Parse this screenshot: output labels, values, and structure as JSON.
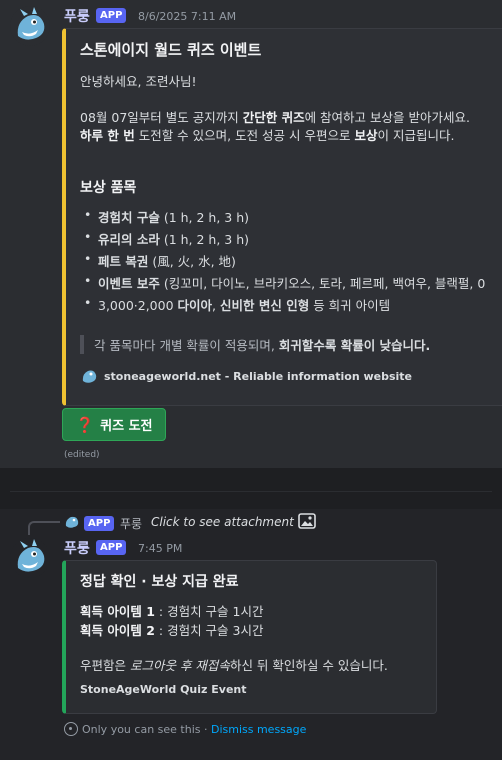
{
  "message1": {
    "username": "푸룽",
    "app_badge": "APP",
    "timestamp": "8/6/2025 7:11 AM",
    "embed": {
      "title": "스톤에이지 월드 퀴즈 이벤트",
      "greeting": "안녕하세요, 조련사님!",
      "p1_a": "08월 07일부터 별도 공지까지 ",
      "p1_b": "간단한 퀴즈",
      "p1_c": "에 참여하고 보상을 받아가세요.",
      "p2_a": "하루 한 번",
      "p2_b": " 도전할 수 있으며, 도전 성공 시 우편으로 ",
      "p2_c": "보상",
      "p2_d": "이 지급됩니다.",
      "reward_heading": "보상 품목",
      "rewards": [
        {
          "bold": "경험치 구슬",
          "rest": " (1 h, 2 h, 3 h)"
        },
        {
          "bold": "유리의 소라",
          "rest": " (1 h, 2 h, 3 h)"
        },
        {
          "bold": "페트 복권",
          "rest": " (風, 火, 水, 地)"
        },
        {
          "bold": "이벤트 보주",
          "rest": " (킹꼬미, 다이노, 브라키오스, 토라, 페르페, 백여우, 블랙펄, 0"
        },
        {
          "pre": "3,000·2,000 ",
          "bold": "다이아",
          "mid": ", ",
          "bold2": "신비한 변신 인형",
          "rest": " 등 희귀 아이템"
        }
      ],
      "note_a": "각 품목마다 개별 확률이 적용되며, ",
      "note_b": "회귀할수록 확률이 낮습니다.",
      "footer": "stoneageworld.net - Reliable information website"
    },
    "button_label": "퀴즈 도전",
    "edited": "(edited)"
  },
  "message2": {
    "reply_badge": "APP",
    "reply_name": "푸룽",
    "reply_text": "Click to see attachment",
    "username": "푸룽",
    "app_badge": "APP",
    "timestamp": "7:45 PM",
    "embed": {
      "title": "정답 확인 · 보상 지급 완료",
      "item1_label": "획득 아이템 1",
      "item1_value": " : 경험치 구슬 1시간",
      "item2_label": "획득 아이템 2",
      "item2_value": " : 경험치 구슬 3시간",
      "mail_a": "우편함은 ",
      "mail_b": "로그아웃 후 재접속",
      "mail_c": "하신 뒤 확인하실 수 있습니다.",
      "footer": "StoneAgeWorld Quiz Event"
    },
    "ephemeral_text": "Only you can see this · ",
    "dismiss": "Dismiss message"
  },
  "colors": {
    "accent_yellow": "#f0c232",
    "accent_green": "#23a55a",
    "button_green": "#248046",
    "badge": "#5865f2",
    "link": "#00a8fc"
  }
}
